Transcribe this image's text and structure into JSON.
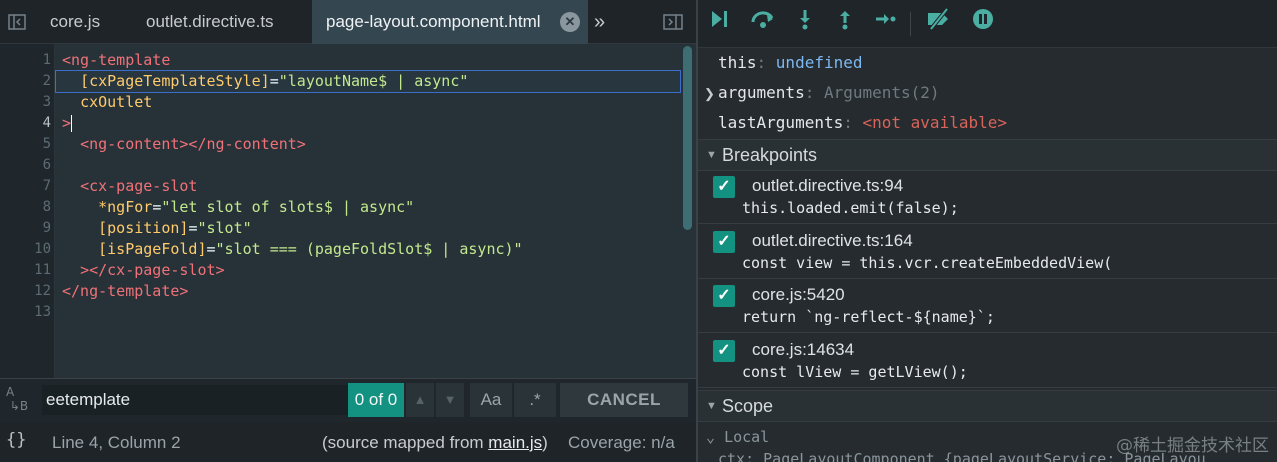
{
  "tabs": [
    {
      "label": "core.js"
    },
    {
      "label": "outlet.directive.ts"
    },
    {
      "label": "page-layout.component.html",
      "active": true
    }
  ],
  "tab_overflow": "»",
  "editor": {
    "lines": [
      {
        "n": "1",
        "html": [
          [
            "tag",
            "<ng-template"
          ]
        ]
      },
      {
        "n": "2",
        "html": [
          [
            "plain",
            "  "
          ],
          [
            "attr",
            "[cxPageTemplateStyle]"
          ],
          [
            "plain",
            "="
          ],
          [
            "str",
            "\"layoutName$ | async\""
          ]
        ]
      },
      {
        "n": "3",
        "html": [
          [
            "plain",
            "  "
          ],
          [
            "attr",
            "cxOutlet"
          ]
        ]
      },
      {
        "n": "4",
        "html": [
          [
            "tag",
            ">"
          ]
        ]
      },
      {
        "n": "5",
        "html": [
          [
            "plain",
            "  "
          ],
          [
            "tag",
            "<ng-content></ng-content>"
          ]
        ]
      },
      {
        "n": "6",
        "html": []
      },
      {
        "n": "7",
        "html": [
          [
            "plain",
            "  "
          ],
          [
            "tag",
            "<cx-page-slot"
          ]
        ]
      },
      {
        "n": "8",
        "html": [
          [
            "plain",
            "    "
          ],
          [
            "attr",
            "*ngFor"
          ],
          [
            "plain",
            "="
          ],
          [
            "str",
            "\"let slot of slots$ | async\""
          ]
        ]
      },
      {
        "n": "9",
        "html": [
          [
            "plain",
            "    "
          ],
          [
            "attr",
            "[position]"
          ],
          [
            "plain",
            "="
          ],
          [
            "str",
            "\"slot\""
          ]
        ]
      },
      {
        "n": "10",
        "html": [
          [
            "plain",
            "    "
          ],
          [
            "attr",
            "[isPageFold]"
          ],
          [
            "plain",
            "="
          ],
          [
            "str",
            "\"slot === (pageFoldSlot$ | async)\""
          ]
        ]
      },
      {
        "n": "11",
        "html": [
          [
            "plain",
            "  "
          ],
          [
            "tag",
            "></cx-page-slot>"
          ]
        ]
      },
      {
        "n": "12",
        "html": [
          [
            "tag",
            "</ng-template>"
          ]
        ]
      },
      {
        "n": "13",
        "html": []
      }
    ]
  },
  "search": {
    "value": "eetemplate",
    "count": "0 of 0",
    "case_label": "Aa",
    "regex_label": ".*",
    "cancel_label": "CANCEL"
  },
  "status": {
    "braces": "{}",
    "position": "Line 4, Column 2",
    "source_prefix": "(source mapped from ",
    "source_file": "main.js",
    "source_suffix": ")",
    "coverage": "Coverage: n/a"
  },
  "vars": {
    "this_name": "this",
    "this_value": "undefined",
    "args_name": "arguments",
    "args_value": "Arguments(2)",
    "last_name": "lastArguments",
    "last_value": "<not available>"
  },
  "breakpoints_title": "Breakpoints",
  "breakpoints": [
    {
      "loc": "outlet.directive.ts:94",
      "code": "this.loaded.emit(false);"
    },
    {
      "loc": "outlet.directive.ts:164",
      "code": "const view = this.vcr.createEmbeddedView("
    },
    {
      "loc": "core.js:5420",
      "code": "return `ng-reflect-${name}`;"
    },
    {
      "loc": "core.js:14634",
      "code": "const lView = getLView();"
    }
  ],
  "scope_title": "Scope",
  "scope_local": "Local",
  "scope_ctx": "ctx: PageLayoutComponent {pageLayoutService: PageLayou",
  "watermark": "@稀土掘金技术社区"
}
